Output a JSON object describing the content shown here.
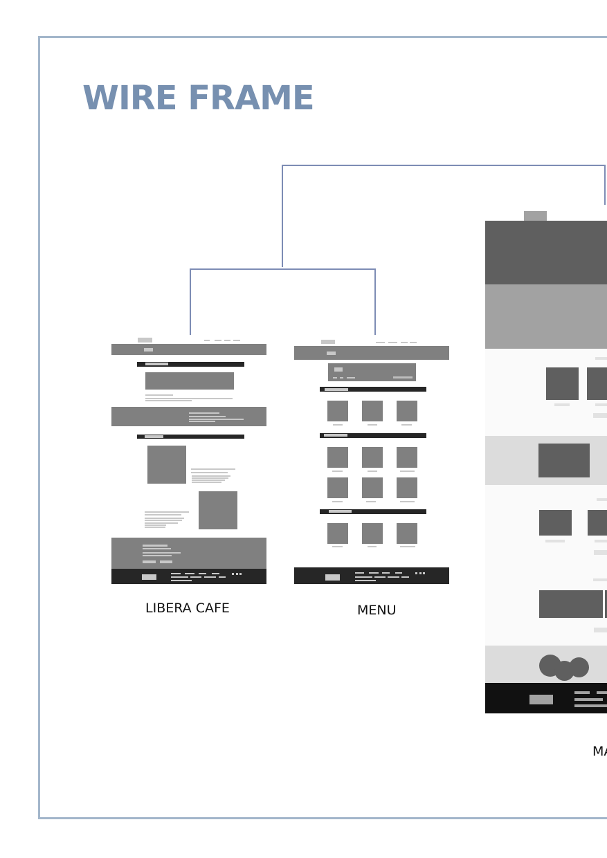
{
  "heading": {
    "title": "WIRE FRAME"
  },
  "captions": {
    "cafe": "LIBERA CAFE",
    "menu": "MENU",
    "map": "MA"
  },
  "colors": {
    "accent": "#7790b0",
    "border": "#a3b6cb",
    "connector": "#7d8cb4"
  }
}
